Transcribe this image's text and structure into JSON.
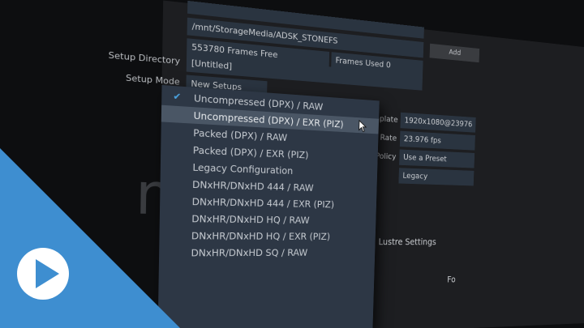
{
  "storage": {
    "path": "/mnt/StorageMedia/ADSK_STONEFS",
    "add_label": "Add",
    "frames_free": "553780 Frames Free",
    "frames_used": "Frames Used 0"
  },
  "setup": {
    "directory_label": "Setup Directory",
    "directory_value": "[Untitled]",
    "mode_label": "Setup Mode",
    "mode_value": "New Setups"
  },
  "project": {
    "config_template_label": "Config Template",
    "config_template_value": "1920x1080@23976",
    "frame_rate_label": "Frame Rate",
    "frame_rate_value": "23.976 fps",
    "colour_policy_label": "Colour Policy",
    "colour_policy_value": "Use a Preset",
    "legacy_value": "Legacy",
    "lustre_settings_label": "Lustre Settings",
    "partial_right_label": "Fo"
  },
  "watermark_text": "me",
  "dropdown": {
    "selected_index": 0,
    "hover_index": 1,
    "options": [
      "Uncompressed (DPX) / RAW",
      "Uncompressed (DPX) / EXR (PIZ)",
      "Packed (DPX) / RAW",
      "Packed (DPX) / EXR (PIZ)",
      "Legacy Configuration",
      "DNxHR/DNxHD 444 / RAW",
      "DNxHR/DNxHD 444 / EXR (PIZ)",
      "DNxHR/DNxHD HQ / RAW",
      "DNxHR/DNxHD HQ / EXR (PIZ)",
      "DNxHR/DNxHD SQ / RAW"
    ]
  },
  "colors": {
    "accent": "#4aa3e0",
    "overlay_blue": "#3e8ed0",
    "panel_bg": "#1d1e21",
    "field_bg": "#2a3440",
    "dropdown_bg": "#2d3745",
    "highlight_bg": "#4a5665"
  },
  "icons": {
    "check": "check-icon",
    "cursor": "mouse-pointer-icon",
    "play": "play-icon"
  }
}
